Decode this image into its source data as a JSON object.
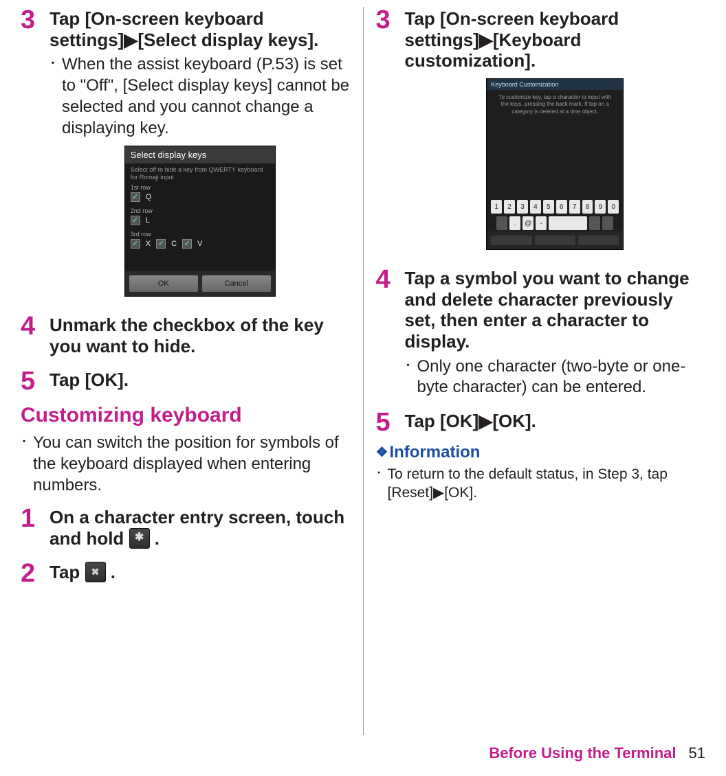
{
  "left": {
    "step3": {
      "num": "3",
      "title_a": "Tap [On-screen keyboard settings]",
      "title_b": "[Select display keys].",
      "bullet": "When the assist keyboard (P.53) is set to \"Off\", [Select display keys] cannot be selected and you cannot change a displaying key."
    },
    "ss1": {
      "title": "Select display keys",
      "desc": "Select off to hide a key from QWERTY keyboard for Romaji input",
      "row1_label": "1st row",
      "row1_key": "Q",
      "row2_label": "2nd row",
      "row2_key": "L",
      "row3_label": "3rd row",
      "row3_keys": [
        "X",
        "C",
        "V"
      ],
      "ok": "OK",
      "cancel": "Cancel"
    },
    "step4": {
      "num": "4",
      "title": "Unmark the checkbox of the key you want to hide."
    },
    "step5": {
      "num": "5",
      "title": "Tap [OK]."
    },
    "heading": "Customizing keyboard",
    "intro": "You can switch the position for symbols of the keyboard displayed when entering numbers.",
    "cstep1": {
      "num": "1",
      "title_a": "On a character entry screen, touch and hold ",
      "title_b": " ."
    },
    "cstep2": {
      "num": "2",
      "title_a": "Tap ",
      "title_b": " ."
    }
  },
  "right": {
    "step3": {
      "num": "3",
      "title_a": "Tap [On-screen keyboard settings]",
      "title_b": "[Keyboard customization]."
    },
    "ss2": {
      "hdr": "Keyboard Customization",
      "msg": "To customize key, tap a character to input with the keys, pressing the back mark. If tap on a category is deleted at a time object."
    },
    "step4": {
      "num": "4",
      "title": "Tap a symbol you want to change and delete character previously set, then enter a character to display.",
      "bullet": "Only one character (two-byte or one-byte character) can be entered."
    },
    "step5": {
      "num": "5",
      "title_a": "Tap [OK]",
      "title_b": "[OK]."
    },
    "info_heading": "Information",
    "info_bullet_a": "To return to the default status, in Step 3, tap [Reset]",
    "info_bullet_b": "[OK]."
  },
  "footer": {
    "title": "Before Using the Terminal",
    "page": "51"
  }
}
